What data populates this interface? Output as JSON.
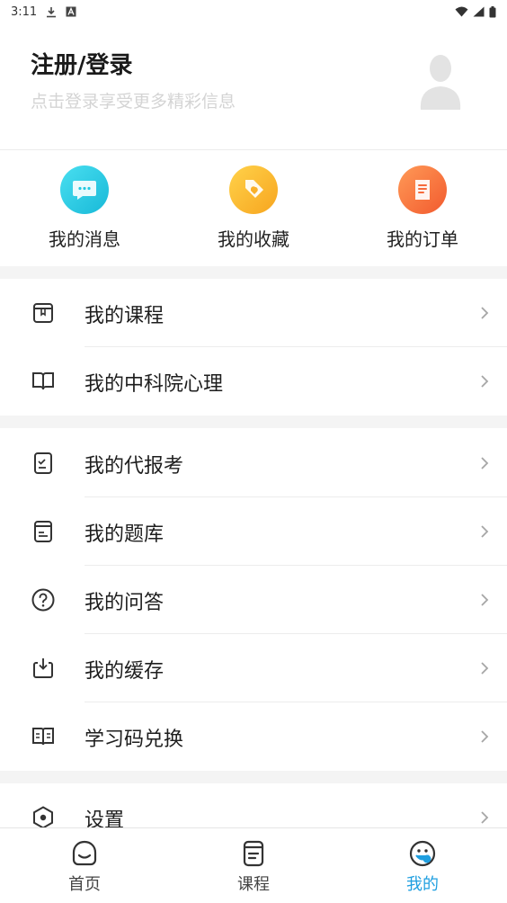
{
  "status_bar": {
    "time": "3:11"
  },
  "profile": {
    "title": "注册/登录",
    "subtitle": "点击登录享受更多精彩信息"
  },
  "quick_actions": [
    {
      "label": "我的消息",
      "icon": "message-icon",
      "color": "#22c8e0"
    },
    {
      "label": "我的收藏",
      "icon": "favorite-tag-icon",
      "color": "#fbb630"
    },
    {
      "label": "我的订单",
      "icon": "order-icon",
      "color": "#f86a3c"
    }
  ],
  "menu_groups": [
    [
      {
        "label": "我的课程",
        "icon": "course-box-icon"
      },
      {
        "label": "我的中科院心理",
        "icon": "open-book-icon"
      }
    ],
    [
      {
        "label": "我的代报考",
        "icon": "checklist-icon"
      },
      {
        "label": "我的题库",
        "icon": "question-bank-icon"
      },
      {
        "label": "我的问答",
        "icon": "question-circle-icon"
      },
      {
        "label": "我的缓存",
        "icon": "download-tray-icon"
      },
      {
        "label": "学习码兑换",
        "icon": "book-code-icon"
      }
    ],
    [
      {
        "label": "设置",
        "icon": "settings-hex-icon"
      }
    ]
  ],
  "bottom_nav": [
    {
      "label": "首页",
      "icon": "home-face-icon",
      "active": false
    },
    {
      "label": "课程",
      "icon": "course-doc-icon",
      "active": false
    },
    {
      "label": "我的",
      "icon": "mine-face-icon",
      "active": true
    }
  ],
  "colors": {
    "accent": "#1f9fe0",
    "divider": "#ececec",
    "section_gap": "#f4f4f4"
  }
}
